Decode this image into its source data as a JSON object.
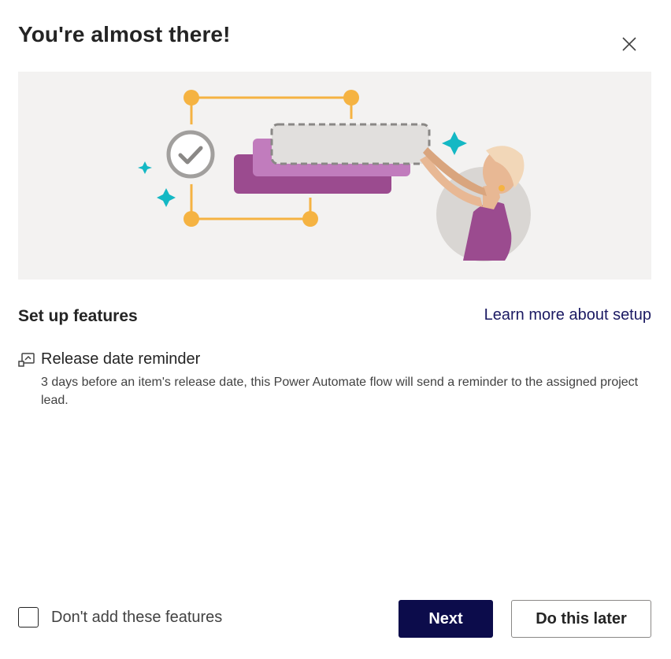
{
  "dialog": {
    "title": "You're almost there!",
    "close_icon": "close-icon"
  },
  "colors": {
    "primary_button": "#0c0c4b",
    "link": "#1b1a63",
    "hero_background": "#f3f2f1",
    "accent_orange": "#f5b342",
    "accent_teal": "#14b8c4",
    "accent_purple": "#a0539b"
  },
  "setup": {
    "title": "Set up features",
    "learn_more": "Learn more about setup"
  },
  "features": [
    {
      "icon": "flow-icon",
      "name": "Release date reminder",
      "description": "3 days before an item's release date, this Power Automate flow will send a reminder to the assigned project lead."
    }
  ],
  "footer": {
    "checkbox_label": "Don't add these features",
    "checkbox_checked": false,
    "next_label": "Next",
    "later_label": "Do this later"
  }
}
